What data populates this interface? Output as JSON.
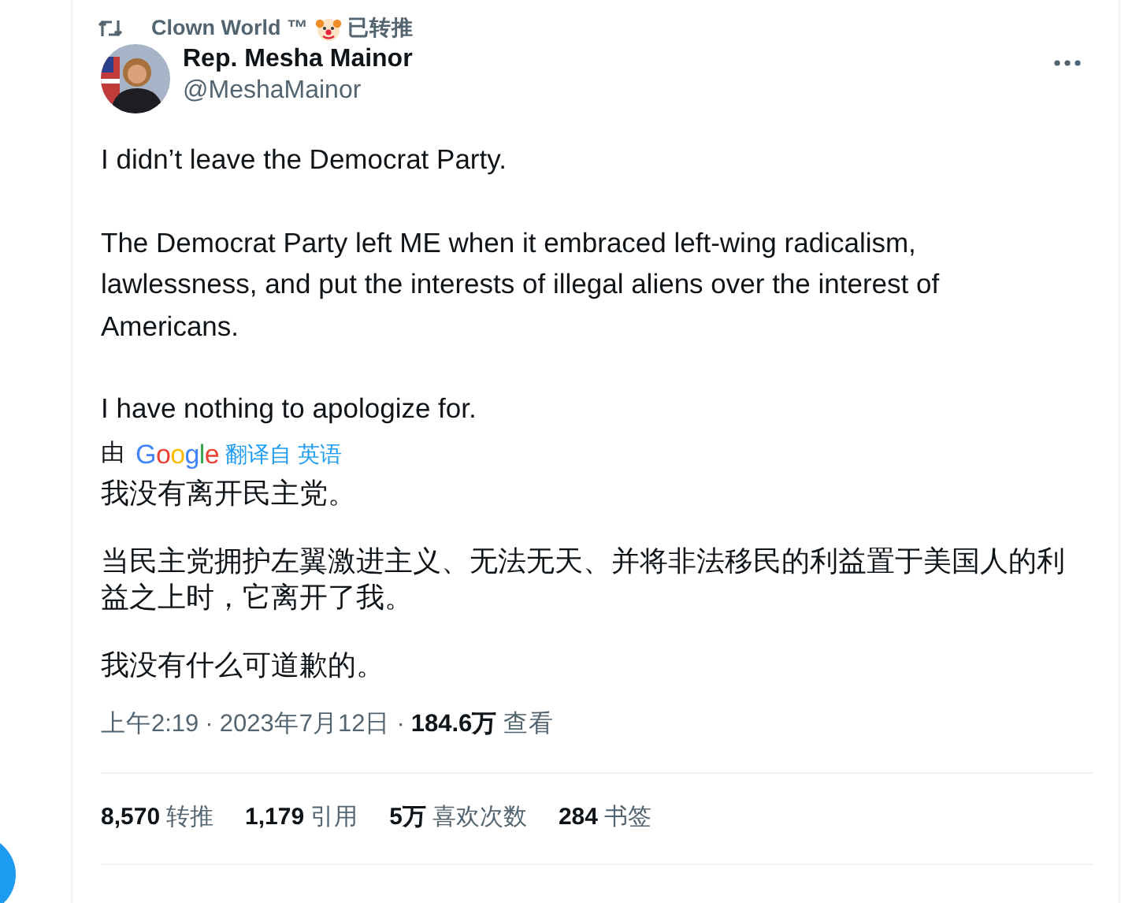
{
  "social_context": {
    "retweeter": "Clown World ™",
    "label": "已转推"
  },
  "author": {
    "name": "Rep. Mesha Mainor",
    "handle": "@MeshaMainor"
  },
  "body": [
    "I didn’t leave the Democrat Party.",
    "The Democrat Party left ME when it embraced left-wing radicalism, lawlessness, and put the interests of illegal aliens over the interest of Americans.",
    "I have nothing to apologize for."
  ],
  "translation": {
    "prefix": "由",
    "provider": "Google",
    "link": "翻译自 英语",
    "paragraphs": [
      "我没有离开民主党。",
      "当民主党拥护左翼激进主义、无法无天、并将非法移民的利益置于美国人的利益之上时，它离开了我。",
      "我没有什么可道歉的。"
    ]
  },
  "meta": {
    "time": "上午2:19",
    "separator_1": "·",
    "date": "2023年7月12日",
    "separator_2": "·",
    "views": "184.6万",
    "views_label": "查看"
  },
  "stats": [
    {
      "count": "8,570",
      "label": "转推"
    },
    {
      "count": "1,179",
      "label": "引用"
    },
    {
      "count": "5万",
      "label": "喜欢次数"
    },
    {
      "count": "284",
      "label": "书签"
    }
  ]
}
